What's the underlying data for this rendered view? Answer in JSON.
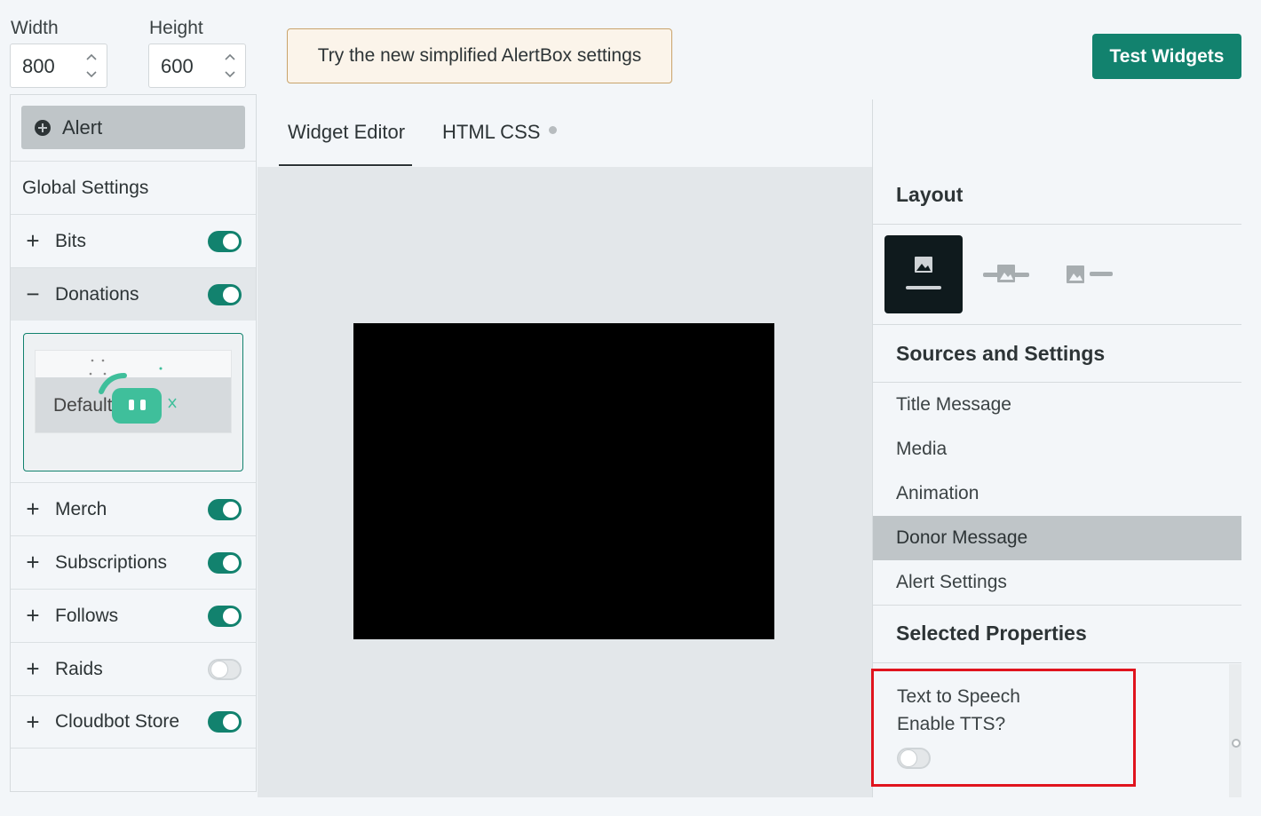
{
  "dimensions": {
    "width_label": "Width",
    "width_value": "800",
    "height_label": "Height",
    "height_value": "600"
  },
  "banner": {
    "text": "Try the new simplified AlertBox settings"
  },
  "test_button": {
    "label": "Test Widgets"
  },
  "sidebar": {
    "alert_button": "Alert",
    "global_settings": "Global Settings",
    "items": [
      {
        "sign": "+",
        "label": "Bits",
        "enabled": true
      },
      {
        "sign": "−",
        "label": "Donations",
        "enabled": true
      },
      {
        "sign": "+",
        "label": "Merch",
        "enabled": true
      },
      {
        "sign": "+",
        "label": "Subscriptions",
        "enabled": true
      },
      {
        "sign": "+",
        "label": "Follows",
        "enabled": true
      },
      {
        "sign": "+",
        "label": "Raids",
        "enabled": false
      },
      {
        "sign": "+",
        "label": "Cloudbot Store",
        "enabled": true
      }
    ],
    "theme_card_label": "Default"
  },
  "tabs": [
    {
      "label": "Widget Editor",
      "active": true
    },
    {
      "label": "HTML CSS",
      "active": false
    }
  ],
  "right_panel": {
    "layout_title": "Layout",
    "sources_title": "Sources and Settings",
    "menu": [
      "Title Message",
      "Media",
      "Animation",
      "Donor Message",
      "Alert Settings"
    ],
    "active_menu": "Donor Message",
    "selected_title": "Selected Properties",
    "tts_section": "Text to Speech",
    "tts_question": "Enable TTS?",
    "tts_enabled": false
  },
  "colors": {
    "accent": "#12826e",
    "highlight_border": "#e0141e",
    "canvas": "#000000"
  }
}
